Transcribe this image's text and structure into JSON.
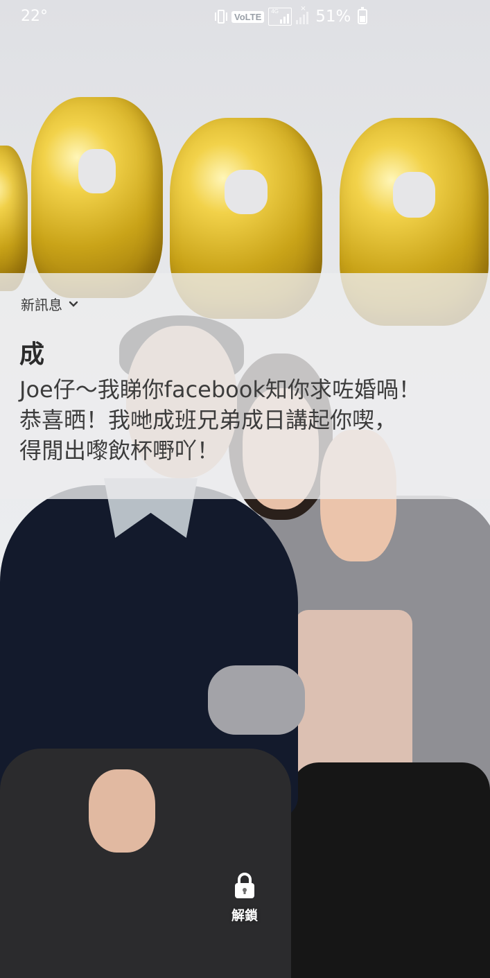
{
  "status_bar": {
    "temperature": "22°",
    "network_badge": "VoLTE",
    "network_type": "4G",
    "battery_percent": "51%",
    "battery_level": 0.51
  },
  "notification": {
    "app_label": "新訊息",
    "sender": "成",
    "message": "Joe仔～我睇你facebook知你求咗婚喎！\n恭喜晒！我哋成班兄弟成日講起你喫，\n得閒出嚟飲杯嘢吖！"
  },
  "lockscreen": {
    "unlock_label": "解鎖",
    "lock_icon": "lock-icon"
  }
}
